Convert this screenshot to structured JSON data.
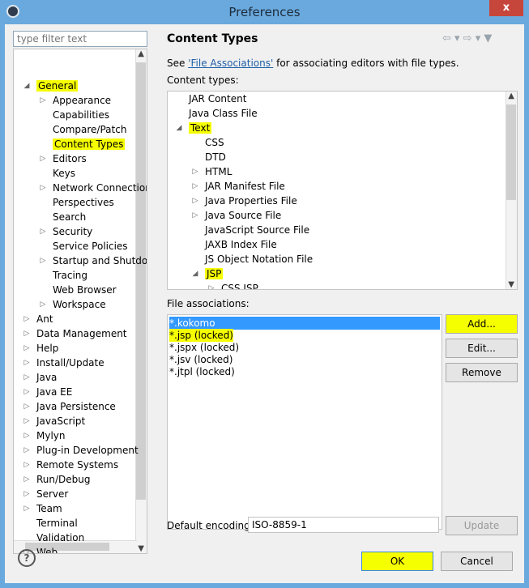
{
  "window": {
    "title": "Preferences",
    "close_label": "x"
  },
  "filter": {
    "placeholder": "type filter text"
  },
  "tree": {
    "items": [
      {
        "label": "General",
        "level": 0,
        "expanded": true
      },
      {
        "label": "Appearance",
        "level": 1,
        "expander": true
      },
      {
        "label": "Capabilities",
        "level": 1,
        "expander": false
      },
      {
        "label": "Compare/Patch",
        "level": 1,
        "expander": false
      },
      {
        "label": "Content Types",
        "level": 1,
        "expander": false,
        "selected": true
      },
      {
        "label": "Editors",
        "level": 1,
        "expander": true
      },
      {
        "label": "Keys",
        "level": 1,
        "expander": false
      },
      {
        "label": "Network Connections",
        "level": 1,
        "expander": true
      },
      {
        "label": "Perspectives",
        "level": 1,
        "expander": false
      },
      {
        "label": "Search",
        "level": 1,
        "expander": false
      },
      {
        "label": "Security",
        "level": 1,
        "expander": true
      },
      {
        "label": "Service Policies",
        "level": 1,
        "expander": false
      },
      {
        "label": "Startup and Shutdown",
        "level": 1,
        "expander": true
      },
      {
        "label": "Tracing",
        "level": 1,
        "expander": false
      },
      {
        "label": "Web Browser",
        "level": 1,
        "expander": false
      },
      {
        "label": "Workspace",
        "level": 1,
        "expander": true
      },
      {
        "label": "Ant",
        "level": 0,
        "expander": true
      },
      {
        "label": "Data Management",
        "level": 0,
        "expander": true
      },
      {
        "label": "Help",
        "level": 0,
        "expander": true
      },
      {
        "label": "Install/Update",
        "level": 0,
        "expander": true
      },
      {
        "label": "Java",
        "level": 0,
        "expander": true
      },
      {
        "label": "Java EE",
        "level": 0,
        "expander": true
      },
      {
        "label": "Java Persistence",
        "level": 0,
        "expander": true
      },
      {
        "label": "JavaScript",
        "level": 0,
        "expander": true
      },
      {
        "label": "Mylyn",
        "level": 0,
        "expander": true
      },
      {
        "label": "Plug-in Development",
        "level": 0,
        "expander": true
      },
      {
        "label": "Remote Systems",
        "level": 0,
        "expander": true
      },
      {
        "label": "Run/Debug",
        "level": 0,
        "expander": true
      },
      {
        "label": "Server",
        "level": 0,
        "expander": true
      },
      {
        "label": "Team",
        "level": 0,
        "expander": true
      },
      {
        "label": "Terminal",
        "level": 0,
        "expander": false
      },
      {
        "label": "Validation",
        "level": 0,
        "expander": false
      },
      {
        "label": "Web",
        "level": 0,
        "expander": true
      }
    ]
  },
  "panel": {
    "title": "Content Types",
    "note_prefix": "See ",
    "note_link": "'File Associations'",
    "note_suffix": " for associating editors with file types.",
    "content_types_label": "Content types:",
    "content_types": [
      {
        "label": "JAR Content",
        "level": 0,
        "expander": false
      },
      {
        "label": "Java Class File",
        "level": 0,
        "expander": false
      },
      {
        "label": "Text",
        "level": 0,
        "expanded": true,
        "highlight": true
      },
      {
        "label": "CSS",
        "level": 1,
        "expander": false
      },
      {
        "label": "DTD",
        "level": 1,
        "expander": false
      },
      {
        "label": "HTML",
        "level": 1,
        "expander": true
      },
      {
        "label": "JAR Manifest File",
        "level": 1,
        "expander": true
      },
      {
        "label": "Java Properties File",
        "level": 1,
        "expander": true
      },
      {
        "label": "Java Source File",
        "level": 1,
        "expander": true
      },
      {
        "label": "JavaScript Source File",
        "level": 1,
        "expander": false
      },
      {
        "label": "JAXB Index File",
        "level": 1,
        "expander": false
      },
      {
        "label": "JS Object Notation File",
        "level": 1,
        "expander": false
      },
      {
        "label": "JSP",
        "level": 1,
        "expanded": true,
        "highlight": true
      },
      {
        "label": "CSS JSP",
        "level": 2,
        "expander": true
      }
    ],
    "file_assoc_label": "File associations:",
    "file_associations": [
      {
        "label": "*.kokomo",
        "selected": true
      },
      {
        "label": "*.jsp (locked)"
      },
      {
        "label": "*.jspx (locked)"
      },
      {
        "label": "*.jsv (locked)"
      },
      {
        "label": "*.jtpl (locked)"
      }
    ],
    "buttons": {
      "add": "Add...",
      "edit": "Edit...",
      "remove": "Remove"
    },
    "encoding_label": "Default encoding:",
    "encoding_value": "ISO-8859-1",
    "update_label": "Update"
  },
  "footer": {
    "ok": "OK",
    "cancel": "Cancel",
    "help": "?"
  }
}
